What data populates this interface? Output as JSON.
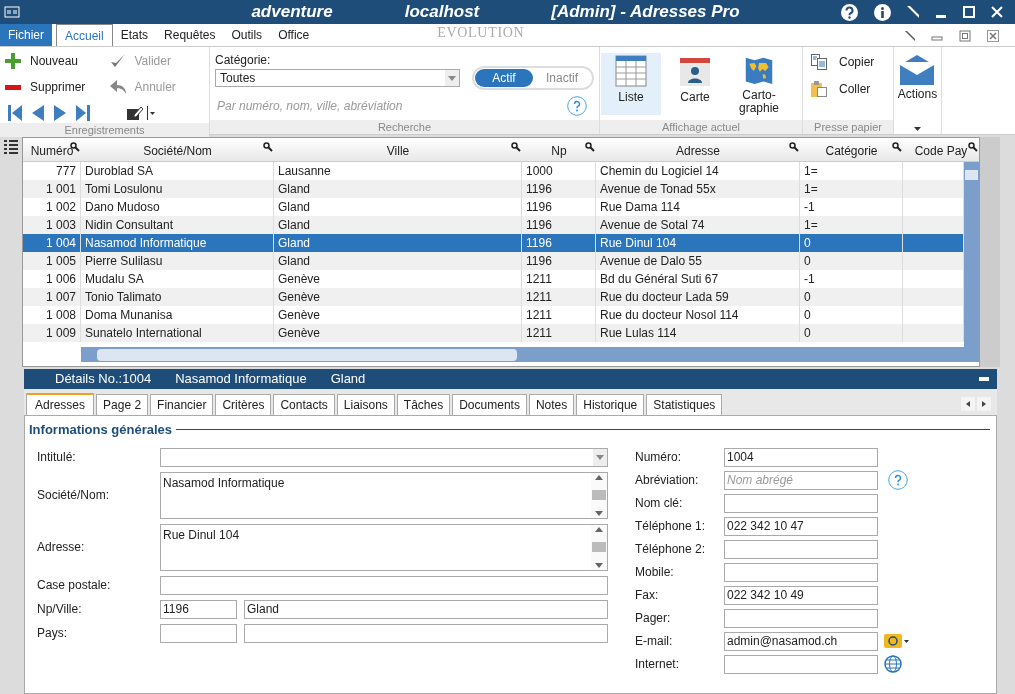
{
  "window": {
    "title_parts": [
      "adventure",
      "localhost",
      "[Admin] - Adresses Pro"
    ]
  },
  "menu_tabs": [
    {
      "label": "Fichier",
      "kind": "file",
      "selected": false
    },
    {
      "label": "Accueil",
      "kind": "tab",
      "selected": true
    },
    {
      "label": "Etats",
      "kind": "tab",
      "selected": false
    },
    {
      "label": "Requêtes",
      "kind": "tab",
      "selected": false
    },
    {
      "label": "Outils",
      "kind": "tab",
      "selected": false
    },
    {
      "label": "Office",
      "kind": "tab",
      "selected": false
    }
  ],
  "brand": "EVOLUTION",
  "records": {
    "label": "Enregistrements",
    "actions": [
      {
        "label": "Nouveau",
        "kind": "add",
        "disabled": false
      },
      {
        "label": "Valider",
        "kind": "check",
        "disabled": true
      },
      {
        "label": "Supprimer",
        "kind": "remove",
        "disabled": false
      },
      {
        "label": "Annuler",
        "kind": "undo",
        "disabled": true
      }
    ]
  },
  "search": {
    "label": "Recherche",
    "category_label": "Catégorie:",
    "category_value": "Toutes",
    "toggle": [
      {
        "label": "Actif",
        "selected": true
      },
      {
        "label": "Inactif",
        "selected": false
      }
    ],
    "placeholder": "Par numéro, nom, ville, abréviation"
  },
  "view": {
    "label": "Affichage actuel",
    "items": [
      {
        "label": "Liste",
        "kind": "list",
        "selected": true
      },
      {
        "label": "Carte",
        "kind": "card",
        "selected": false
      },
      {
        "label": "Carto-\ngraphie",
        "kind": "map",
        "selected": false
      }
    ]
  },
  "clipboard": {
    "label": "Presse papier",
    "items": [
      {
        "label": "Copier",
        "kind": "copy"
      },
      {
        "label": "Coller",
        "kind": "paste"
      }
    ]
  },
  "actions_label": "Actions",
  "table": {
    "columns": [
      "Numéro",
      "Société/Nom",
      "Ville",
      "Np",
      "Adresse",
      "Catégorie",
      "Code Pay"
    ],
    "rows": [
      {
        "cells": [
          "777",
          "Duroblad SA",
          "Lausanne",
          "1000",
          "Chemin du Logiciel 14",
          "1=",
          ""
        ],
        "selected": false
      },
      {
        "cells": [
          "1 001",
          "Tomi Losulonu",
          "Gland",
          "1196",
          "Avenue de Tonad 55x",
          "1=",
          ""
        ],
        "selected": false
      },
      {
        "cells": [
          "1 002",
          "Dano Mudoso",
          "Gland",
          "1196",
          "Rue Dama 114",
          "-1",
          ""
        ],
        "selected": false
      },
      {
        "cells": [
          "1 003",
          "Nidin Consultant",
          "Gland",
          "1196",
          "Avenue de Sotal  74",
          "1=",
          ""
        ],
        "selected": false
      },
      {
        "cells": [
          "1 004",
          "Nasamod Informatique",
          "Gland",
          "1196",
          "Rue Dinul 104",
          "0",
          ""
        ],
        "selected": true
      },
      {
        "cells": [
          "1 005",
          "Pierre Sulilasu",
          "Gland",
          "1196",
          "Avenue de Dalo 55",
          "0",
          ""
        ],
        "selected": false
      },
      {
        "cells": [
          "1 006",
          "Mudalu SA",
          "Genève",
          "1211",
          "Bd du Général Suti 67",
          "-1",
          ""
        ],
        "selected": false
      },
      {
        "cells": [
          "1 007",
          "Tonio Talimato",
          "Genève",
          "1211",
          "Rue du docteur Lada 59",
          "0",
          ""
        ],
        "selected": false
      },
      {
        "cells": [
          "1 008",
          "Doma Munanisa",
          "Genève",
          "1211",
          "Rue du docteur Nosol 114",
          "0",
          ""
        ],
        "selected": false
      },
      {
        "cells": [
          "1 009",
          "Sunatelo International",
          "Genève",
          "1211",
          "Rue Lulas 114",
          "0",
          ""
        ],
        "selected": false
      }
    ]
  },
  "details": {
    "header": [
      "Détails No.:1004",
      "Nasamod Informatique",
      "Gland"
    ],
    "tabs": [
      {
        "label": "Adresses",
        "selected": true
      },
      {
        "label": "Page 2",
        "selected": false
      },
      {
        "label": "Financier",
        "selected": false
      },
      {
        "label": "Critères",
        "selected": false
      },
      {
        "label": "Contacts",
        "selected": false
      },
      {
        "label": "Liaisons",
        "selected": false
      },
      {
        "label": "Tâches",
        "selected": false
      },
      {
        "label": "Documents",
        "selected": false
      },
      {
        "label": "Notes",
        "selected": false
      },
      {
        "label": "Historique",
        "selected": false
      },
      {
        "label": "Statistiques",
        "selected": false
      }
    ],
    "section": "Informations générales",
    "left": [
      {
        "label": "Intitulé:",
        "kind": "select"
      },
      {
        "label": "Société/Nom:",
        "kind": "textarea",
        "value": "Nasamod Informatique"
      },
      {
        "label": "Adresse:",
        "kind": "textarea",
        "value": "Rue Dinul 104"
      },
      {
        "label": "Case postale:",
        "kind": "input"
      },
      {
        "label": "Np/Ville:",
        "kind": "pair",
        "value": "1196",
        "value2": "Gland"
      },
      {
        "label": "Pays:",
        "kind": "pair"
      }
    ],
    "right": [
      {
        "label": "Numéro:",
        "value": "1004",
        "kind": "input"
      },
      {
        "label": "Abréviation:",
        "placeholder": "Nom abrégé",
        "kind": "help"
      },
      {
        "label": "Nom clé:",
        "kind": "input"
      },
      {
        "label": "Téléphone 1:",
        "value": "022 342 10 47",
        "kind": "input"
      },
      {
        "label": "Téléphone 2:",
        "kind": "input"
      },
      {
        "label": "Mobile:",
        "kind": "input"
      },
      {
        "label": "Fax:",
        "value": "022 342 10 49",
        "kind": "input"
      },
      {
        "label": "Pager:",
        "kind": "input"
      },
      {
        "label": "E-mail:",
        "value": "admin@nasamod.ch",
        "kind": "email"
      },
      {
        "label": "Internet:",
        "kind": "web"
      }
    ]
  }
}
